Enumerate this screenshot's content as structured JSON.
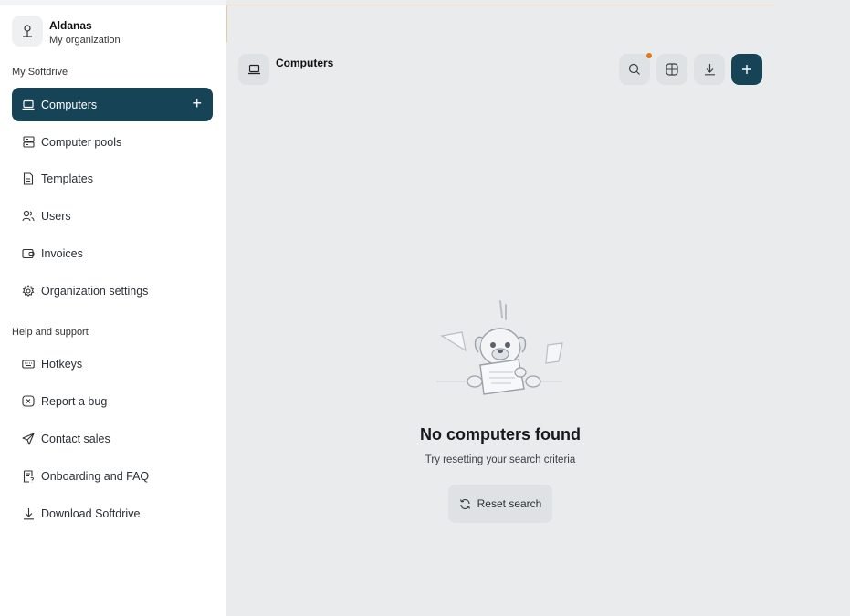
{
  "user": {
    "name": "Aldanas",
    "organization": "My organization",
    "avatar_icon": "user-icon"
  },
  "sections": {
    "my_softdrive": "My Softdrive",
    "help": "Help and support"
  },
  "nav": [
    {
      "label": "Computers",
      "icon": "laptop-icon",
      "active": true,
      "action_icon": "plus-icon"
    },
    {
      "label": "Computer pools",
      "icon": "server-icon"
    },
    {
      "label": "Templates",
      "icon": "document-icon"
    },
    {
      "label": "Users",
      "icon": "users-icon"
    },
    {
      "label": "Invoices",
      "icon": "wallet-icon"
    },
    {
      "label": "Organization settings",
      "icon": "gear-icon"
    }
  ],
  "help_nav": [
    {
      "label": "Hotkeys",
      "icon": "keyboard-icon"
    },
    {
      "label": "Report a bug",
      "icon": "bug-report-icon"
    },
    {
      "label": "Contact sales",
      "icon": "send-icon"
    },
    {
      "label": "Onboarding and FAQ",
      "icon": "faq-icon"
    },
    {
      "label": "Download Softdrive",
      "icon": "download-icon"
    }
  ],
  "header": {
    "title": "Computers",
    "title_icon": "laptop-icon",
    "tools": [
      "search-icon",
      "grid-view-icon",
      "download-icon",
      "plus-icon"
    ]
  },
  "empty_state": {
    "title": "No computers found",
    "subtitle": "Try resetting your search criteria",
    "reset_label": "Reset search",
    "illustration": "confused-dog-illustration"
  },
  "colors": {
    "accent": "#164356",
    "notification": "#e07a1f",
    "background": "#e9ebed"
  }
}
